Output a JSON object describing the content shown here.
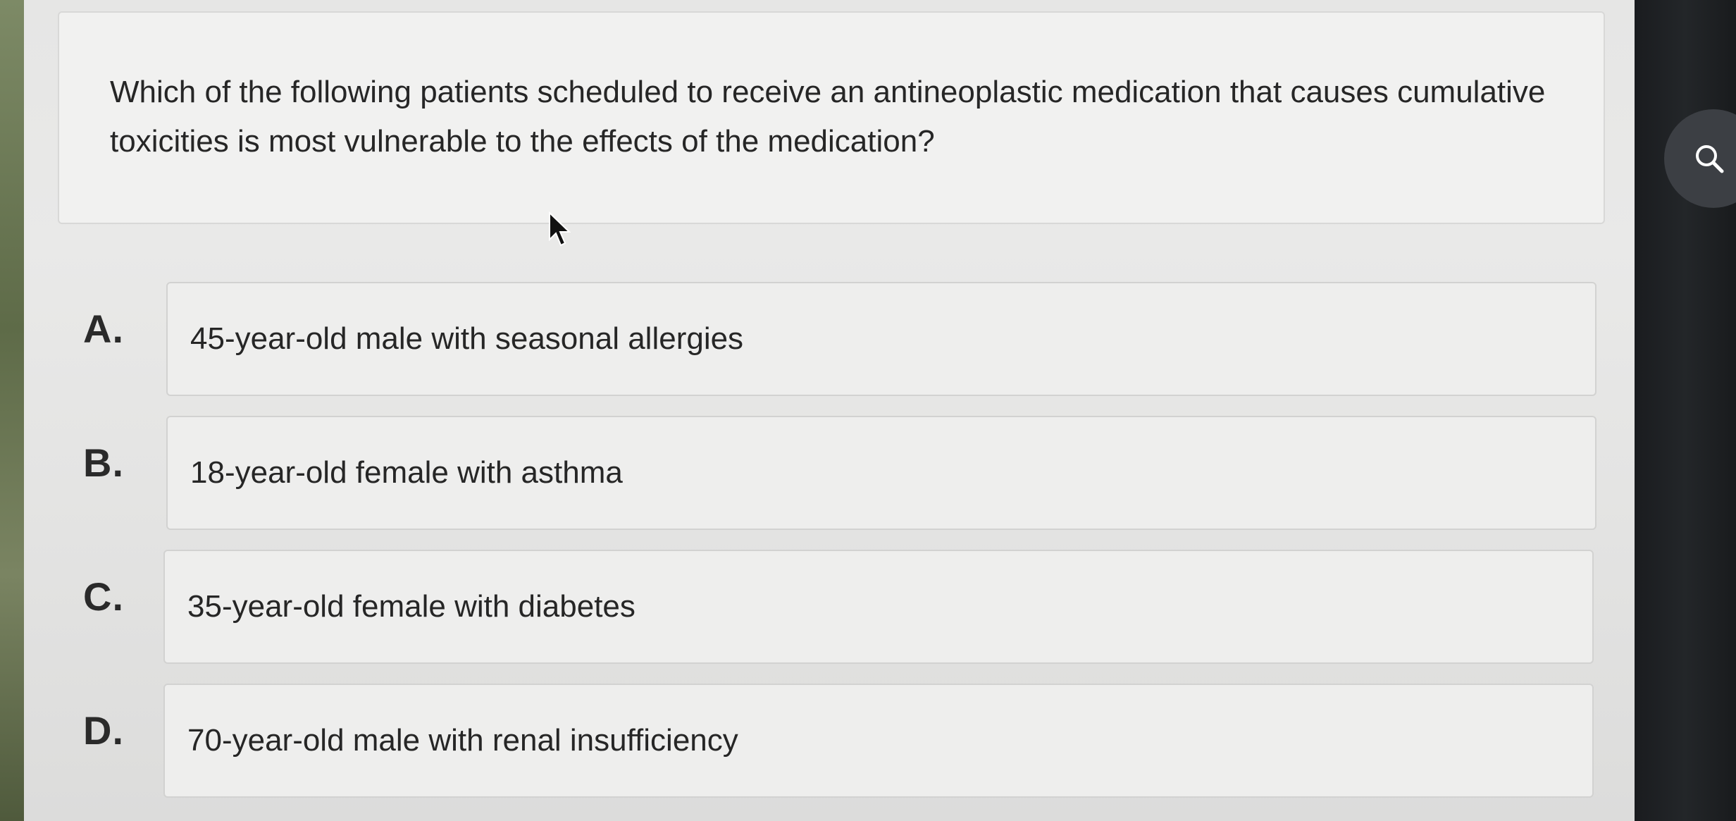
{
  "question": {
    "text": "Which of the following patients scheduled to receive an antineoplastic medication that causes cumulative toxicities is most vulnerable to the effects of the medication?"
  },
  "options": [
    {
      "letter": "A.",
      "text": "45-year-old male with seasonal allergies"
    },
    {
      "letter": "B.",
      "text": "18-year-old female with asthma"
    },
    {
      "letter": "C.",
      "text": "35-year-old female with diabetes"
    },
    {
      "letter": "D.",
      "text": "70-year-old male with renal insufficiency"
    }
  ],
  "icons": {
    "search": "search-icon",
    "cursor": "mouse-pointer-icon"
  },
  "colors": {
    "card_background": "#f1f1f0",
    "text": "#262626",
    "bezel": "#1f2124",
    "fab": "#3c3f44"
  }
}
